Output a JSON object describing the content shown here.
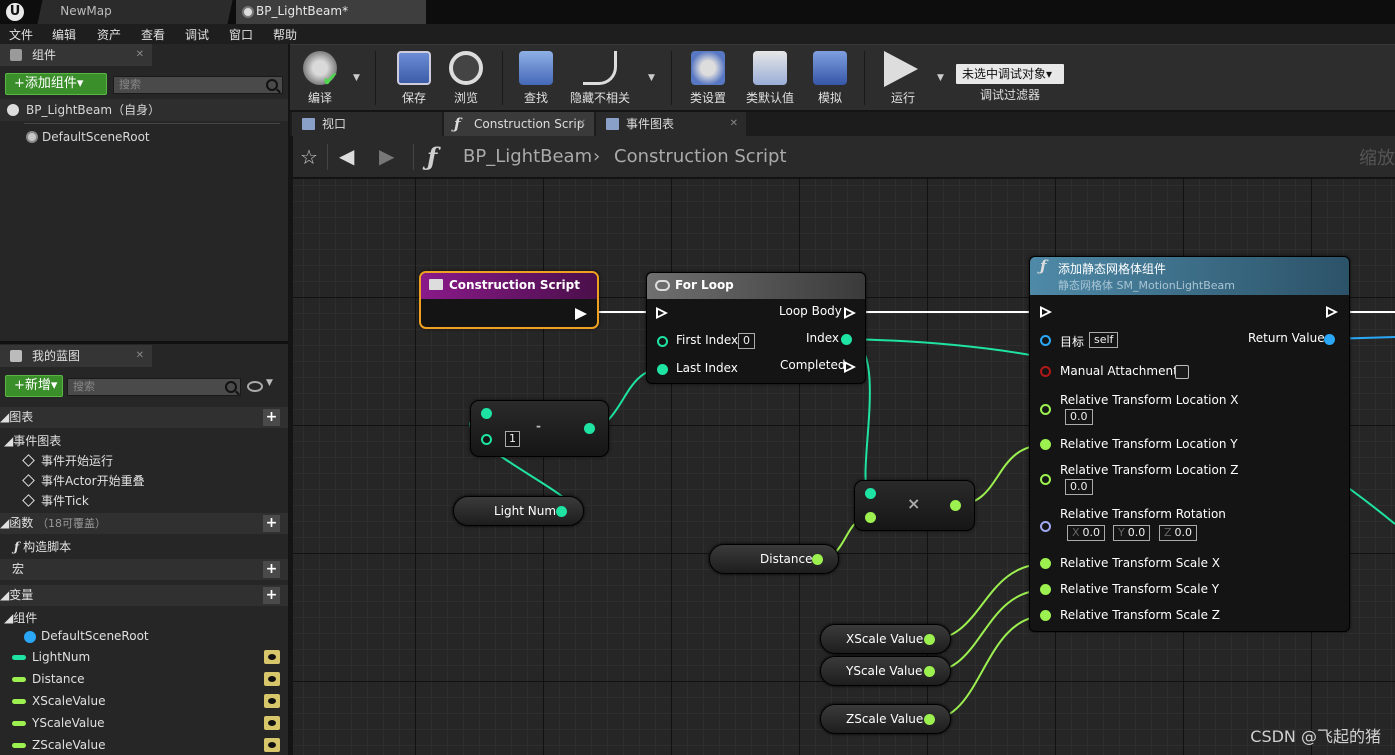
{
  "titlebar": {
    "logo": "U",
    "tabs": [
      {
        "label": "NewMap"
      },
      {
        "label": "BP_LightBeam*"
      }
    ]
  },
  "menu": [
    "文件",
    "编辑",
    "资产",
    "查看",
    "调试",
    "窗口",
    "帮助"
  ],
  "components_panel": {
    "tab_label": "组件",
    "add_button": "+添加组件▾",
    "search_placeholder": "搜索",
    "items": [
      {
        "label": "BP_LightBeam（自身）"
      },
      {
        "label": "DefaultSceneRoot"
      }
    ]
  },
  "my_blueprint": {
    "tab_label": "我的蓝图",
    "new_button": "+新增▾",
    "search_placeholder": "搜索",
    "sections": {
      "graphs": "◢图表",
      "event_graph": "◢事件图表",
      "events": [
        "事件开始运行",
        "事件Actor开始重叠",
        "事件Tick"
      ],
      "functions": "◢函数",
      "functions_note": "（18可覆盖）",
      "construction": "构造脚本",
      "macros": "宏",
      "variables": "◢变量",
      "components": "◢组件",
      "component_items": [
        "DefaultSceneRoot"
      ],
      "variable_items": [
        {
          "label": "LightNum",
          "color": "#1ee3a3"
        },
        {
          "label": "Distance",
          "color": "#9cf050"
        },
        {
          "label": "XScaleValue",
          "color": "#9cf050"
        },
        {
          "label": "YScaleValue",
          "color": "#9cf050"
        },
        {
          "label": "ZScaleValue",
          "color": "#9cf050"
        }
      ]
    }
  },
  "toolbar": {
    "buttons": [
      "编译",
      "保存",
      "浏览",
      "查找",
      "隐藏不相关",
      "类设置",
      "类默认值",
      "模拟",
      "运行"
    ],
    "debug_select": "未选中调试对象▾",
    "debug_filter": "调试过滤器"
  },
  "editor_tabs": [
    "视口",
    "Construction Scrip",
    "事件图表"
  ],
  "breadcrumb": {
    "blueprint": "BP_LightBeam",
    "separator": "›",
    "graph": "Construction Script",
    "zoom": "缩放"
  },
  "nodes": {
    "construction_script": {
      "title": "Construction Script"
    },
    "for_loop": {
      "title": "For Loop",
      "loop_body": "Loop Body",
      "first_index": "First Index",
      "first_index_value": "0",
      "last_index": "Last Index",
      "index": "Index",
      "completed": "Completed"
    },
    "subtract": {
      "symbol": "-",
      "value": "1"
    },
    "multiply": {
      "symbol": "×"
    },
    "light_num": {
      "label": "Light Num"
    },
    "distance": {
      "label": "Distance"
    },
    "xscale": {
      "label": "XScale Value"
    },
    "yscale": {
      "label": "YScale Value"
    },
    "zscale": {
      "label": "ZScale Value"
    },
    "add_mesh": {
      "title": "添加静态网格体组件",
      "subtitle": "静态网格体 SM_MotionLightBeam",
      "target": "目标",
      "target_value": "self",
      "return_value": "Return Value",
      "manual_attachment": "Manual Attachment",
      "loc_x": "Relative Transform Location X",
      "loc_x_value": "0.0",
      "loc_y": "Relative Transform Location Y",
      "loc_z": "Relative Transform Location Z",
      "loc_z_value": "0.0",
      "rotation": "Relative Transform Rotation",
      "rot_x": "0.0",
      "rot_y": "0.0",
      "rot_z": "0.0",
      "axis_x": "X",
      "axis_y": "Y",
      "axis_z": "Z",
      "scale_x": "Relative Transform Scale X",
      "scale_y": "Relative Transform Scale Y",
      "scale_z": "Relative Transform Scale Z"
    }
  },
  "watermark": "CSDN @飞起的猪"
}
